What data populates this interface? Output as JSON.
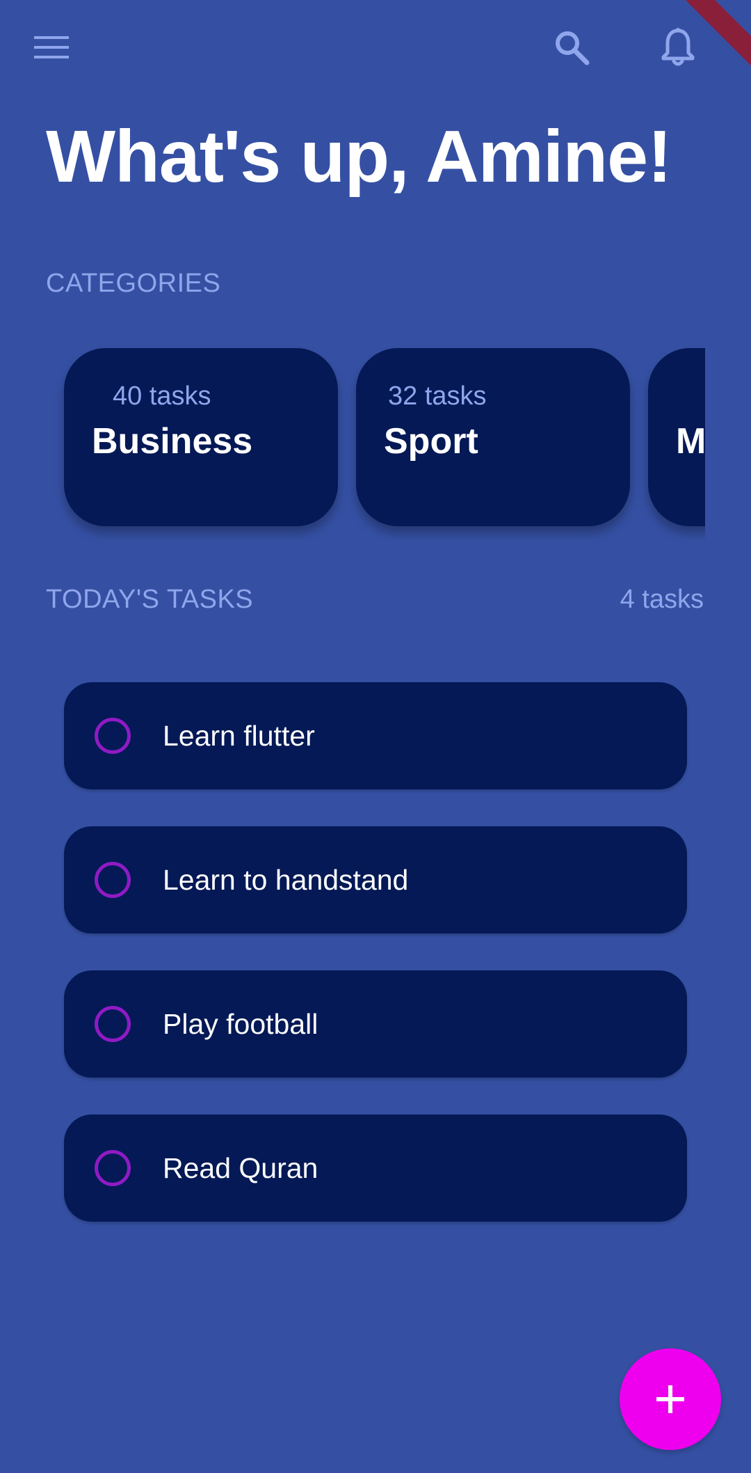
{
  "header": {
    "menu_icon": "menu-icon",
    "search_icon": "search-icon",
    "notifications_icon": "bell-icon",
    "greeting": "What's up, Amine!"
  },
  "categories": {
    "label": "CATEGORIES",
    "items": [
      {
        "count": "40 tasks",
        "name": "Business"
      },
      {
        "count": "32 tasks",
        "name": "Sport"
      },
      {
        "count": "",
        "name": "M"
      }
    ]
  },
  "today": {
    "label": "TODAY'S TASKS",
    "count": "4 tasks",
    "tasks": [
      {
        "title": "Learn flutter",
        "done": false
      },
      {
        "title": "Learn to handstand",
        "done": false
      },
      {
        "title": "Play football",
        "done": false
      },
      {
        "title": "Read Quran",
        "done": false
      }
    ]
  },
  "fab": {
    "icon": "plus-icon"
  },
  "colors": {
    "background": "#3550a3",
    "card": "#041955",
    "accent_muted": "#8fa6ec",
    "checkbox": "#8f1bc4",
    "fab": "#ee00ee"
  }
}
